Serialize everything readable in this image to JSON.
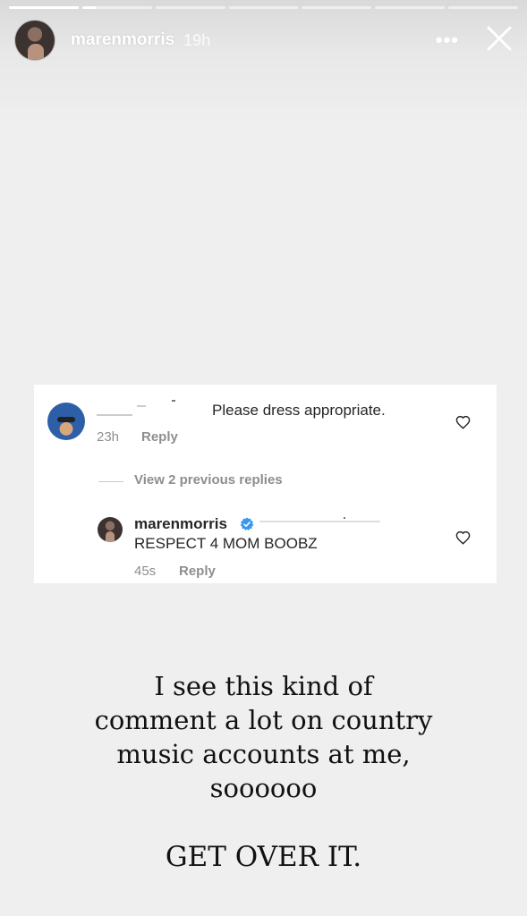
{
  "story": {
    "progress": [
      1.0,
      0.2,
      0,
      0,
      0,
      0,
      0
    ],
    "username": "marenmorris",
    "time": "19h",
    "more_icon": "more-horizontal-icon",
    "close_icon": "close-icon"
  },
  "comment_card": {
    "comment1": {
      "text": "Please dress appropriate.",
      "time": "23h",
      "reply_label": "Reply"
    },
    "view_replies_label": "View 2 previous replies",
    "comment2": {
      "username": "marenmorris",
      "verified": true,
      "text": "RESPECT 4 MOM BOOBZ",
      "time": "45s",
      "reply_label": "Reply"
    }
  },
  "caption": {
    "lines": [
      "I see this kind of",
      "comment a lot on country",
      "music accounts at me,",
      "soooooo"
    ],
    "emphasis": "GET OVER IT."
  }
}
